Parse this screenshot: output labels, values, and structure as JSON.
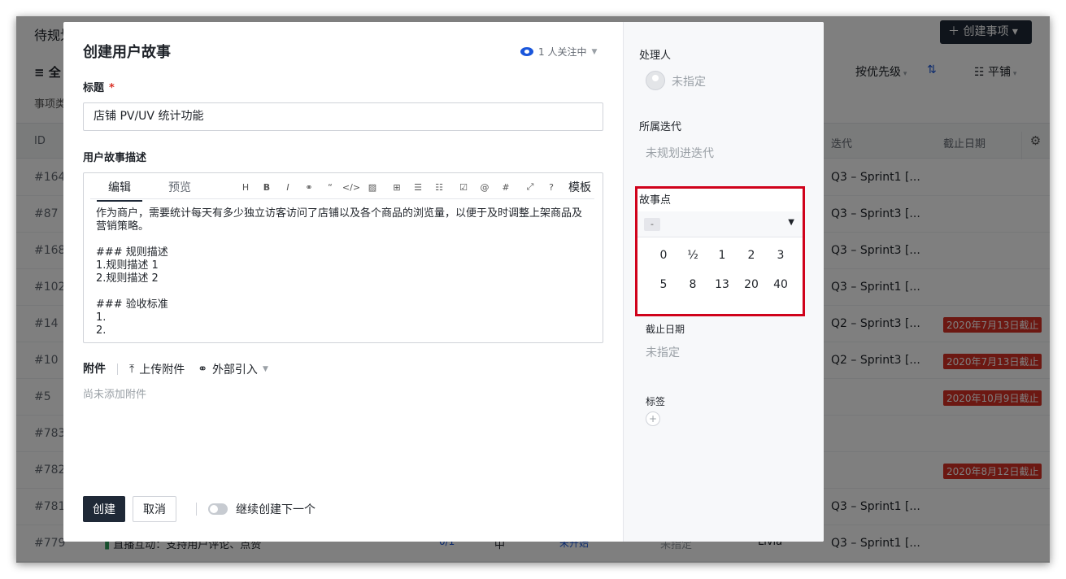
{
  "background": {
    "page_title": "待规划",
    "create_button": "＋ 创建事项 ▾",
    "filter_all": "全",
    "type_label": "事项类",
    "sort_label": "按优先级",
    "view_mode": "平铺",
    "headers": {
      "id": "ID",
      "iteration": "迭代",
      "due": "截止日期"
    },
    "rows": [
      {
        "id": "#164",
        "iteration": "Q3 – Sprint1 [...",
        "due": ""
      },
      {
        "id": "#87",
        "iteration": "Q3 – Sprint3 [...",
        "due": ""
      },
      {
        "id": "#168",
        "iteration": "Q3 – Sprint3 [...",
        "due": ""
      },
      {
        "id": "#102",
        "iteration": "Q3 – Sprint1 [...",
        "due": ""
      },
      {
        "id": "#14",
        "iteration": "Q2 – Sprint3 [...",
        "due": "2020年7月13日截止"
      },
      {
        "id": "#10",
        "iteration": "Q2 – Sprint3 [...",
        "due": "2020年7月13日截止"
      },
      {
        "id": "#5",
        "iteration": "",
        "due": "2020年10月9日截止"
      },
      {
        "id": "#783",
        "iteration": "",
        "due": ""
      },
      {
        "id": "#782",
        "iteration": "",
        "due": "2020年8月12日截止"
      },
      {
        "id": "#781",
        "iteration": "Q3 – Sprint1 [...",
        "due": ""
      },
      {
        "id": "#779",
        "iteration": "Q3 – Sprint1 [...",
        "due": ""
      }
    ],
    "last_row": {
      "title": "直播互动：支持用户评论、点赞",
      "progress": "0/1",
      "priority": "中",
      "status": "未开始",
      "assignee": "未指定",
      "owner": "Livia"
    }
  },
  "modal": {
    "title": "创建用户故事",
    "watchers": "1 人关注中",
    "title_label": "标题",
    "required_mark": "*",
    "title_value": "店铺 PV/UV 统计功能",
    "desc_label": "用户故事描述",
    "tab_edit": "编辑",
    "tab_preview": "预览",
    "toolbar": {
      "heading": "H",
      "bold": "B",
      "italic": "I",
      "link": "⚭",
      "quote": "“",
      "code": "</>",
      "image": "▨",
      "table": "⊞",
      "ordered_list": "☰",
      "bullet_list": "☷",
      "task": "☑",
      "mention": "@",
      "tag": "#",
      "expand": "⤢",
      "help": "?",
      "template": "模板"
    },
    "desc_lines": [
      "作为商户，需要统计每天有多少独立访客访问了店铺以及各个商品的浏览量，以便于及时调整上架商品及营销策略。",
      "",
      "### 规则描述",
      "1.规则描述 1",
      "2.规则描述 2",
      "",
      "### 验收标准",
      "1.",
      "2."
    ],
    "attach_label": "附件",
    "upload_label": "上传附件",
    "external_label": "外部引入",
    "attach_empty": "尚未添加附件",
    "create_btn": "创建",
    "cancel_btn": "取消",
    "continue_label": "继续创建下一个"
  },
  "sidebar": {
    "assignee_label": "处理人",
    "assignee_value": "未指定",
    "iteration_label": "所属迭代",
    "iteration_value": "未规划进迭代",
    "story_points_label": "故事点",
    "story_points_value": "-",
    "story_point_options": [
      "0",
      "½",
      "1",
      "2",
      "3",
      "5",
      "8",
      "13",
      "20",
      "40"
    ],
    "due_label": "截止日期",
    "due_value": "未指定",
    "tags_label": "标签",
    "tags_add": "+"
  },
  "colors": {
    "primary": "#1f2937",
    "accent": "#1a56db",
    "highlight_box": "#d0021b",
    "danger": "#d93025"
  }
}
